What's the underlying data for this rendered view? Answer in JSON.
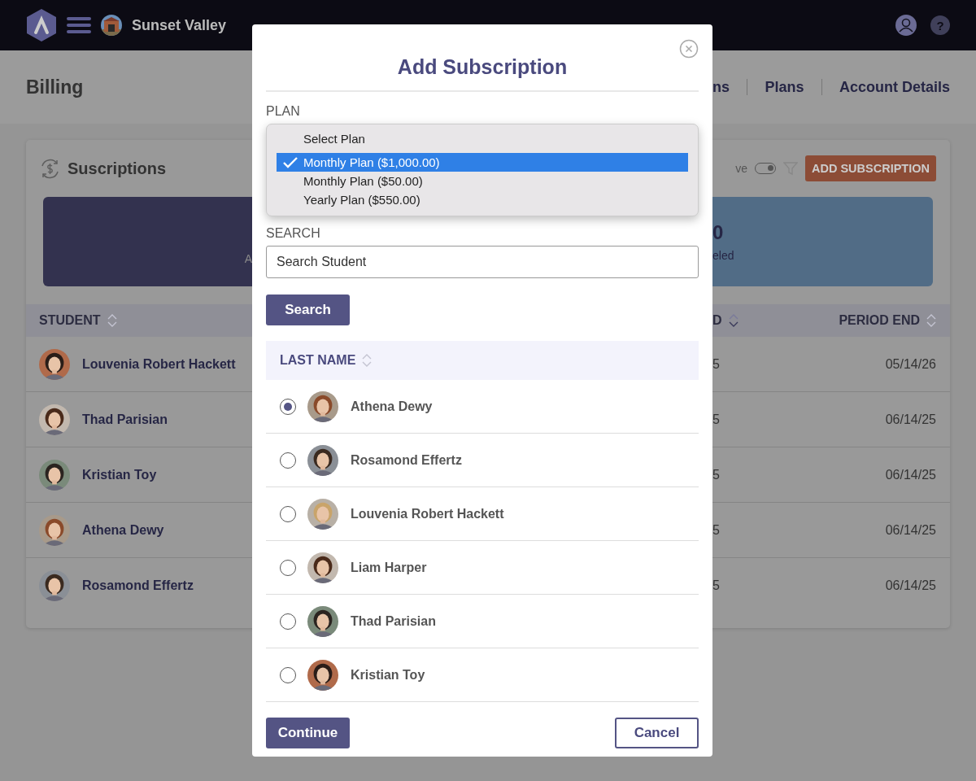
{
  "top_bar": {
    "org_name": "Sunset Valley",
    "help_icon": "?"
  },
  "page": {
    "title": "Billing",
    "tabs": [
      {
        "label": "ns",
        "selected": false
      },
      {
        "label": "Plans",
        "selected": false
      },
      {
        "label": "Account Details",
        "selected": false
      }
    ]
  },
  "card": {
    "title": "Suscriptions",
    "filter_label": "ve",
    "toggle": {
      "on": true
    },
    "add_button": "ADD SUBSCRIPTION",
    "stat_cards": [
      {
        "label": "A",
        "color": "#33324f"
      },
      {
        "value": "0",
        "label": "eled",
        "color": "#516c86"
      }
    ],
    "columns": [
      {
        "label": "STUDENT"
      },
      {
        "label": "D"
      },
      {
        "label": "PERIOD END"
      }
    ],
    "rows": [
      {
        "student": "Louvenia Robert Hackett",
        "column_2": "5",
        "period_end": "05/14/26"
      },
      {
        "student": "Thad Parisian",
        "column_2": "5",
        "period_end": "06/14/25"
      },
      {
        "student": "Kristian Toy",
        "column_2": "5",
        "period_end": "06/14/25"
      },
      {
        "student": "Athena Dewy",
        "column_2": "5",
        "period_end": "06/14/25"
      },
      {
        "student": "Rosamond Effertz",
        "column_2": "5",
        "period_end": "06/14/25"
      }
    ]
  },
  "modal": {
    "title": "Add Subscription",
    "plan_label": "PLAN",
    "plan_options": [
      {
        "label": "Select Plan",
        "selected": false
      },
      {
        "label": "Monthly Plan ($1,000.00)",
        "selected": true
      },
      {
        "label": "Monthly Plan ($50.00)",
        "selected": false
      },
      {
        "label": "Yearly Plan ($550.00)",
        "selected": false
      }
    ],
    "search_label": "SEARCH",
    "search_placeholder": "Search Student",
    "search_button": "Search",
    "list_header": "LAST NAME",
    "students": [
      {
        "name": "Athena Dewy",
        "selected": true
      },
      {
        "name": "Rosamond Effertz",
        "selected": false
      },
      {
        "name": "Louvenia Robert Hackett",
        "selected": false
      },
      {
        "name": "Liam Harper",
        "selected": false
      },
      {
        "name": "Thad Parisian",
        "selected": false
      },
      {
        "name": "Kristian Toy",
        "selected": false
      }
    ],
    "continue_button": "Continue",
    "cancel_button": "Cancel"
  }
}
